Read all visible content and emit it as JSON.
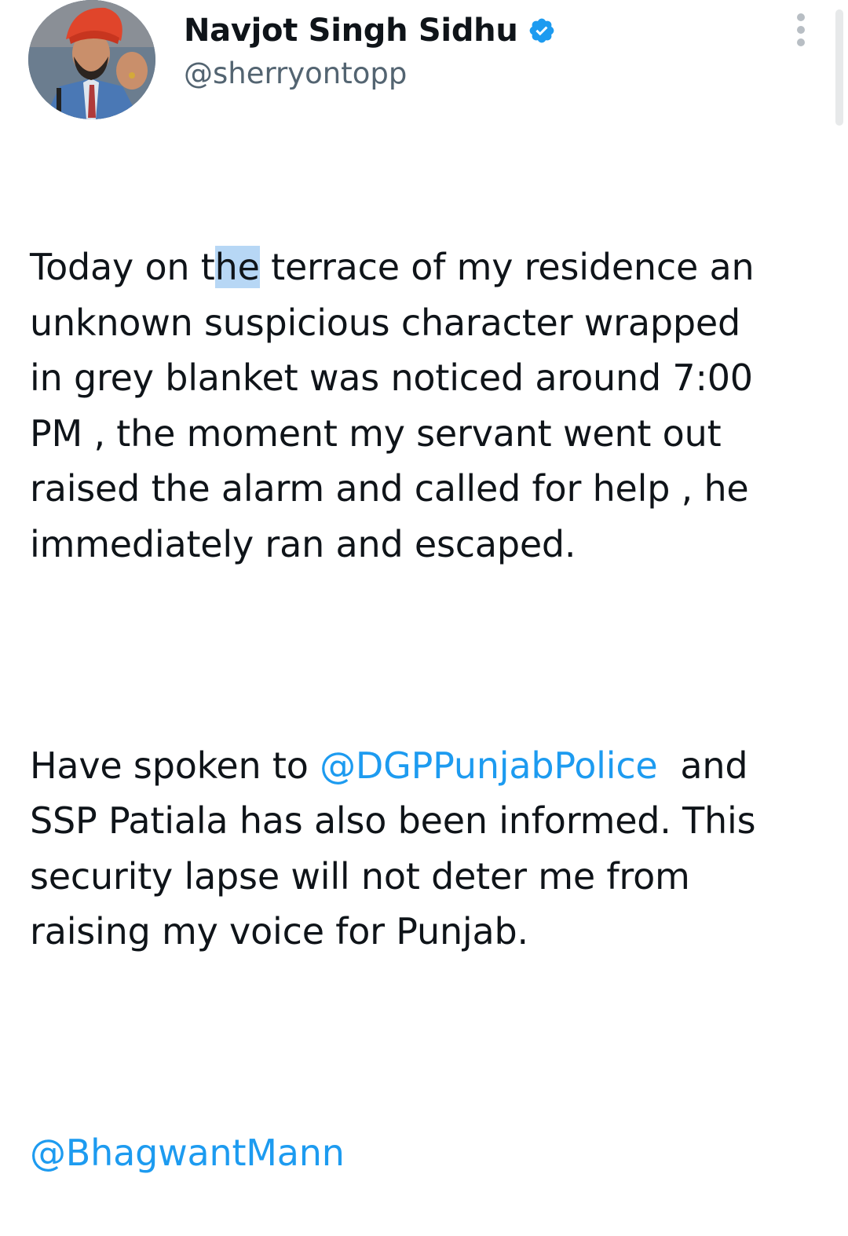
{
  "author": {
    "display_name": "Navjot Singh Sidhu",
    "handle": "@sherryontopp",
    "verified": true
  },
  "tweet": {
    "p1_before_highlight": "Today on t",
    "p1_highlight": "he",
    "p1_rest": " terrace of my residence an\nunknown suspicious character wrapped\nin grey blanket was noticed around 7:00\nPM , the moment my servant went out\nraised the alarm and called for help , he\nimmediately ran and escaped.",
    "p2_before_mention": "Have spoken to ",
    "p2_mention": "@DGPPunjabPolice",
    "p2_rest": "  and\nSSP Patiala has also been informed. This\nsecurity lapse will not deter me from\nraising my voice for Punjab.",
    "p3_mention": "@BhagwantMann"
  },
  "colors": {
    "link": "#1d9bf0",
    "verified": "#1d9bf0",
    "text": "#0f1419",
    "secondary": "#536471",
    "selection": "#b7d7f5"
  },
  "icons": {
    "verified": "verified-badge-icon",
    "more": "more-vertical-icon"
  }
}
